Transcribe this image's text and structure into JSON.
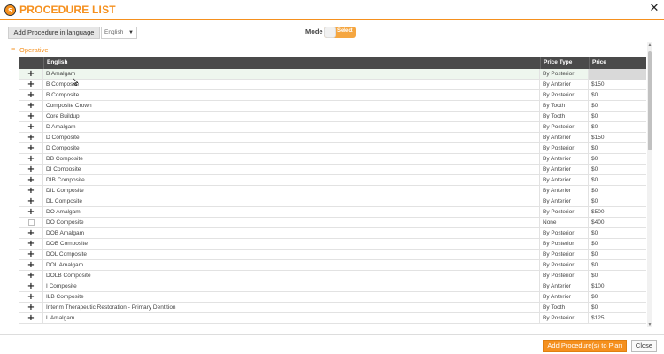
{
  "header": {
    "title": "PROCEDURE LIST",
    "logo_letter": "S",
    "close_glyph": "✕"
  },
  "toolbar": {
    "lang_button": "Add Procedure in language",
    "lang_select": "English",
    "mode_label": "Mode",
    "mode_toggle_text": "Select"
  },
  "section": {
    "label": "Operative",
    "collapse_glyph": "−"
  },
  "table": {
    "columns": {
      "name": "English",
      "type": "Price Type",
      "price": "Price"
    },
    "rows": [
      {
        "icon": "plus",
        "name": "B Amalgam",
        "type": "By Posterior",
        "price": ""
      },
      {
        "icon": "plus",
        "name": "B Composite",
        "type": "By Anterior",
        "price": "$150"
      },
      {
        "icon": "plus",
        "name": "B Composite",
        "type": "By Posterior",
        "price": "$0"
      },
      {
        "icon": "plus",
        "name": "Composite Crown",
        "type": "By Tooth",
        "price": "$0"
      },
      {
        "icon": "plus",
        "name": "Core Buildup",
        "type": "By Tooth",
        "price": "$0"
      },
      {
        "icon": "plus",
        "name": "D Amalgam",
        "type": "By Posterior",
        "price": "$0"
      },
      {
        "icon": "plus",
        "name": "D Composite",
        "type": "By Anterior",
        "price": "$150"
      },
      {
        "icon": "plus",
        "name": "D Composite",
        "type": "By Posterior",
        "price": "$0"
      },
      {
        "icon": "plus",
        "name": "DB Composite",
        "type": "By Anterior",
        "price": "$0"
      },
      {
        "icon": "plus",
        "name": "DI Composite",
        "type": "By Anterior",
        "price": "$0"
      },
      {
        "icon": "plus",
        "name": "DIB Composite",
        "type": "By Anterior",
        "price": "$0"
      },
      {
        "icon": "plus",
        "name": "DIL Composite",
        "type": "By Anterior",
        "price": "$0"
      },
      {
        "icon": "plus",
        "name": "DL Composite",
        "type": "By Anterior",
        "price": "$0"
      },
      {
        "icon": "plus",
        "name": "DO Amalgam",
        "type": "By Posterior",
        "price": "$500"
      },
      {
        "icon": "checkbox",
        "name": "DO Composite",
        "type": "None",
        "price": "$400"
      },
      {
        "icon": "plus",
        "name": "DOB Amalgam",
        "type": "By Posterior",
        "price": "$0"
      },
      {
        "icon": "plus",
        "name": "DOB Composite",
        "type": "By Posterior",
        "price": "$0"
      },
      {
        "icon": "plus",
        "name": "DOL Composite",
        "type": "By Posterior",
        "price": "$0"
      },
      {
        "icon": "plus",
        "name": "DOL Amalgam",
        "type": "By Posterior",
        "price": "$0"
      },
      {
        "icon": "plus",
        "name": "DOLB Composite",
        "type": "By Posterior",
        "price": "$0"
      },
      {
        "icon": "plus",
        "name": "I Composite",
        "type": "By Anterior",
        "price": "$100"
      },
      {
        "icon": "plus",
        "name": "ILB Composite",
        "type": "By Anterior",
        "price": "$0"
      },
      {
        "icon": "plus",
        "name": "Interim Therapeutic Restoration - Primary Dentition",
        "type": "By Tooth",
        "price": "$0"
      },
      {
        "icon": "plus",
        "name": "L Amalgam",
        "type": "By Posterior",
        "price": "$125"
      }
    ]
  },
  "footer": {
    "add_button": "Add Procedure(s) to Plan",
    "close_button": "Close"
  },
  "colors": {
    "accent": "#f5901e",
    "header_row": "#4a4a4a",
    "highlight_row": "#eef6ee"
  }
}
